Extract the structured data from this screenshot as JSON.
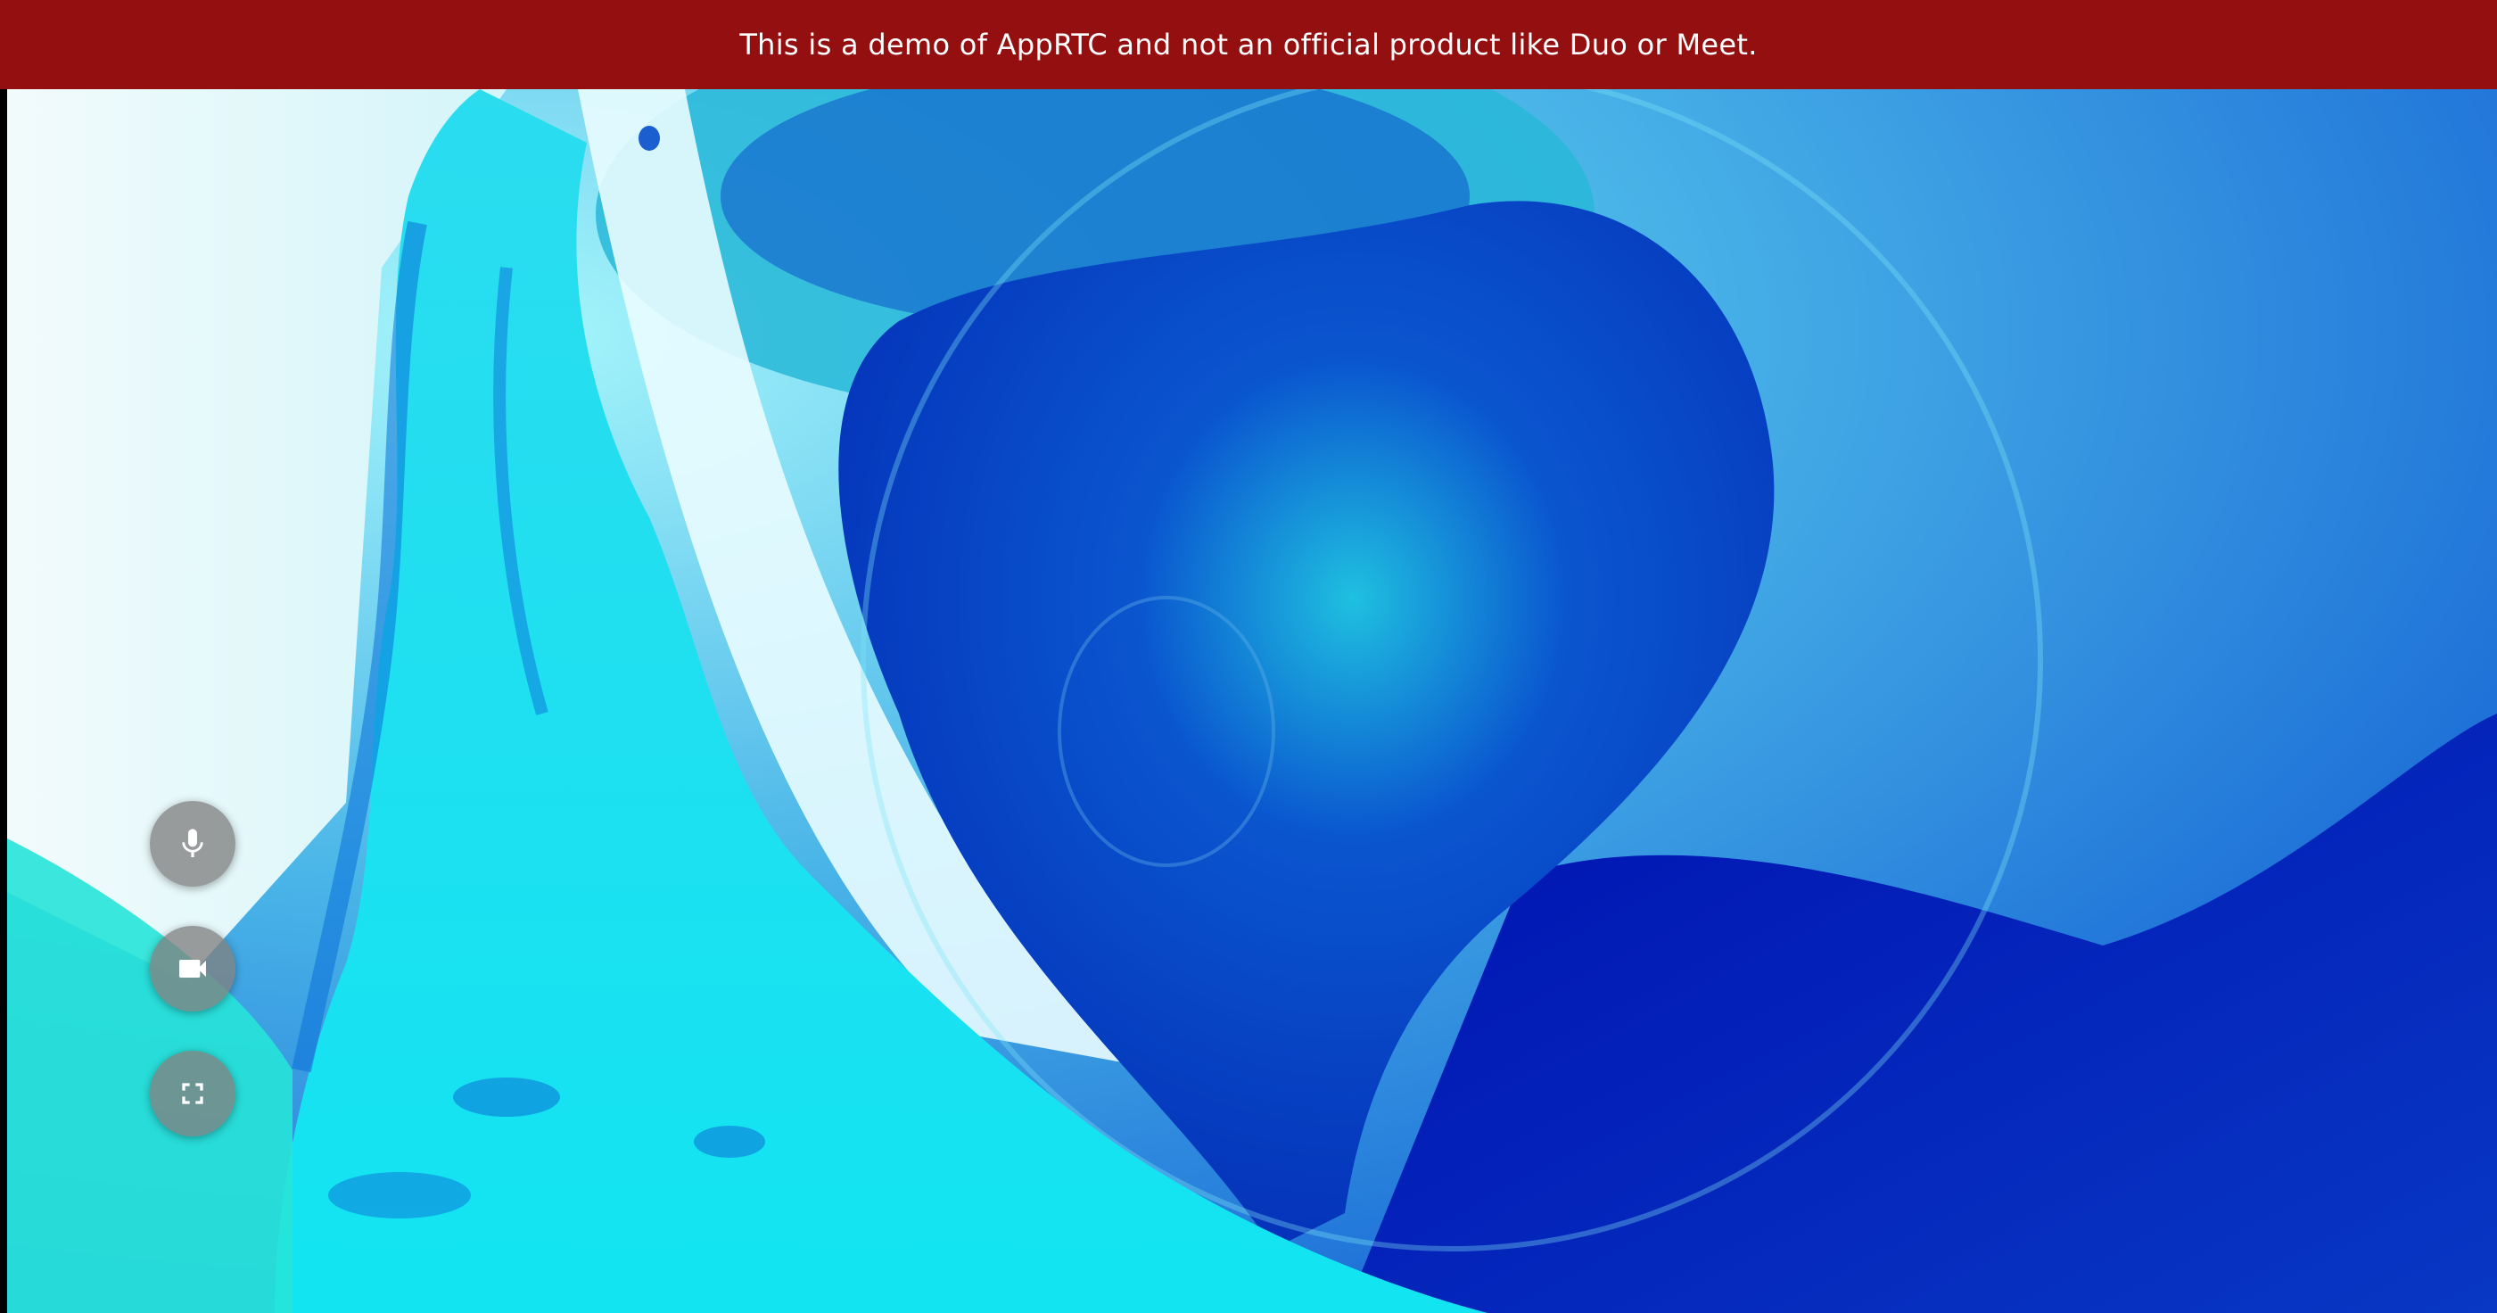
{
  "banner": {
    "text": "This is a demo of AppRTC and not an official product like Duo or Meet.",
    "background_color": "#941010"
  },
  "controls": [
    {
      "name": "mute-audio-button",
      "icon": "mic-icon"
    },
    {
      "name": "mute-video-button",
      "icon": "videocam-icon"
    },
    {
      "name": "fullscreen-button",
      "icon": "fullscreen-icon"
    }
  ]
}
